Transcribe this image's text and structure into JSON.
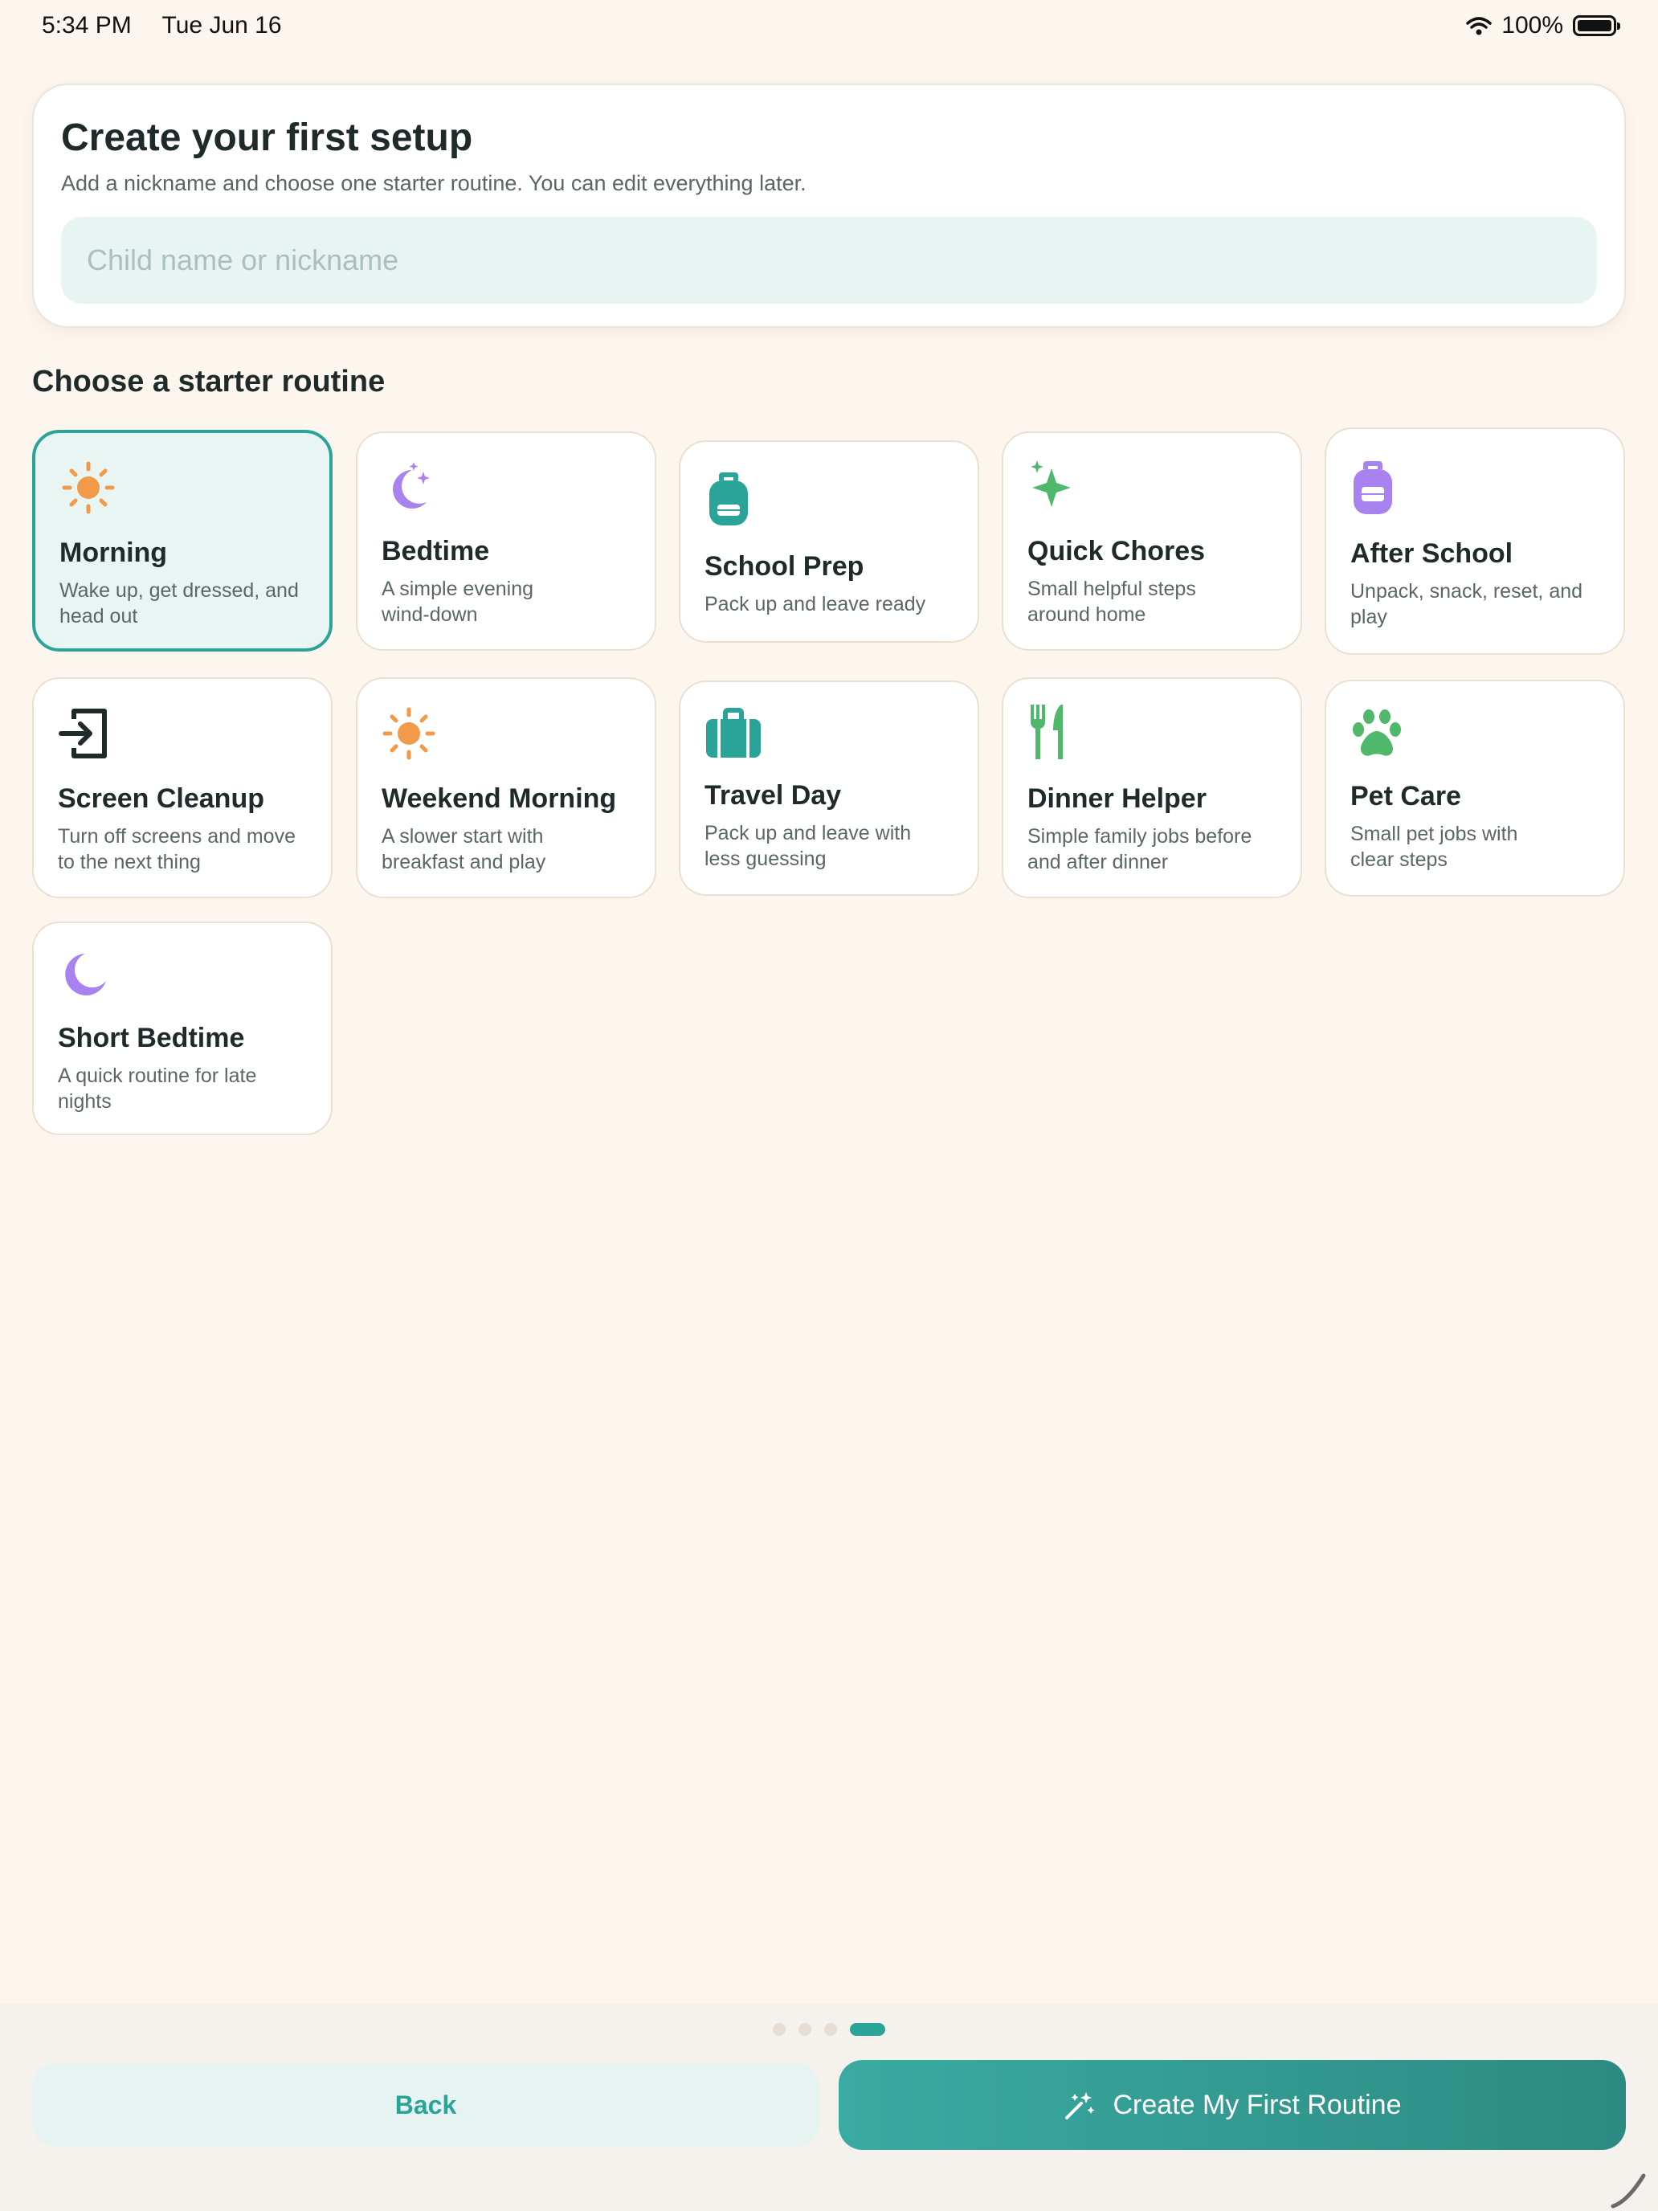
{
  "status_bar": {
    "time": "5:34 PM",
    "date": "Tue Jun 16",
    "battery": "100%"
  },
  "setup": {
    "title": "Create your first setup",
    "subtitle": "Add a nickname and choose one starter routine. You can edit everything later.",
    "name_placeholder": "Child name or nickname",
    "name_value": ""
  },
  "section_title": "Choose a starter routine",
  "routines": [
    {
      "title": "Morning",
      "desc": "Wake up, get dressed, and head out",
      "icon": "sun-icon",
      "selected": true
    },
    {
      "title": "Bedtime",
      "desc": "A simple evening wind-down",
      "icon": "moon-stars-icon",
      "selected": false
    },
    {
      "title": "School Prep",
      "desc": "Pack up and leave ready",
      "icon": "backpack-icon",
      "selected": false
    },
    {
      "title": "Quick Chores",
      "desc": "Small helpful steps around home",
      "icon": "sparkles-icon",
      "selected": false
    },
    {
      "title": "After School",
      "desc": "Unpack, snack, reset, and play",
      "icon": "backpack-icon",
      "selected": false
    },
    {
      "title": "Screen Cleanup",
      "desc": "Turn off screens and move to the next thing",
      "icon": "exit-icon",
      "selected": false
    },
    {
      "title": "Weekend Morning",
      "desc": "A slower start with breakfast and play",
      "icon": "sun-icon",
      "selected": false
    },
    {
      "title": "Travel Day",
      "desc": "Pack up and leave with less guessing",
      "icon": "suitcase-icon",
      "selected": false
    },
    {
      "title": "Dinner Helper",
      "desc": "Simple family jobs before and after dinner",
      "icon": "fork-knife-icon",
      "selected": false
    },
    {
      "title": "Pet Care",
      "desc": "Small pet jobs with clear steps",
      "icon": "paw-icon",
      "selected": false
    },
    {
      "title": "Short Bedtime",
      "desc": "A quick routine for late nights",
      "icon": "moon-icon",
      "selected": false
    }
  ],
  "pager": {
    "total": 4,
    "current": 4
  },
  "buttons": {
    "back": "Back",
    "create": "Create My First Routine"
  },
  "colors": {
    "accent": "#2aa399",
    "background": "#fdf6ee",
    "orange": "#f29a4a",
    "purple": "#a883ef",
    "green": "#4fb86b"
  }
}
